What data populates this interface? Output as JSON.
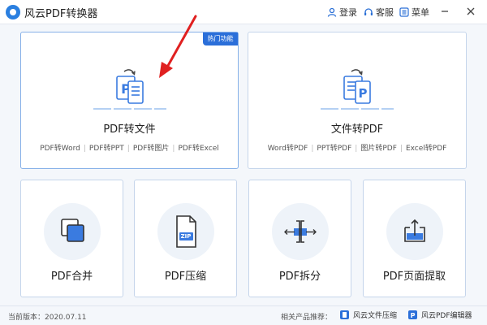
{
  "window": {
    "title": "风云PDF转换器",
    "login_label": "登录",
    "service_label": "客服",
    "menu_label": "菜单"
  },
  "main_cards": [
    {
      "title": "PDF转文件",
      "badge": "热门功能",
      "subitems": [
        "PDF转Word",
        "PDF转PPT",
        "PDF转图片",
        "PDF转Excel"
      ]
    },
    {
      "title": "文件转PDF",
      "subitems": [
        "Word转PDF",
        "PPT转PDF",
        "图片转PDF",
        "Excel转PDF"
      ]
    }
  ],
  "tool_cards": [
    {
      "title": "PDF合并"
    },
    {
      "title": "PDF压缩",
      "icon_text": "ZIP"
    },
    {
      "title": "PDF拆分"
    },
    {
      "title": "PDF页面提取"
    }
  ],
  "footer": {
    "version": "当前版本：2020.07.11",
    "related_label": "相关产品推荐：",
    "products": [
      "风云文件压缩",
      "风云PDF编辑器"
    ]
  },
  "colors": {
    "accent": "#2b6fd9",
    "icon_blue": "#3a7be0",
    "arrow_red": "#e02020"
  }
}
